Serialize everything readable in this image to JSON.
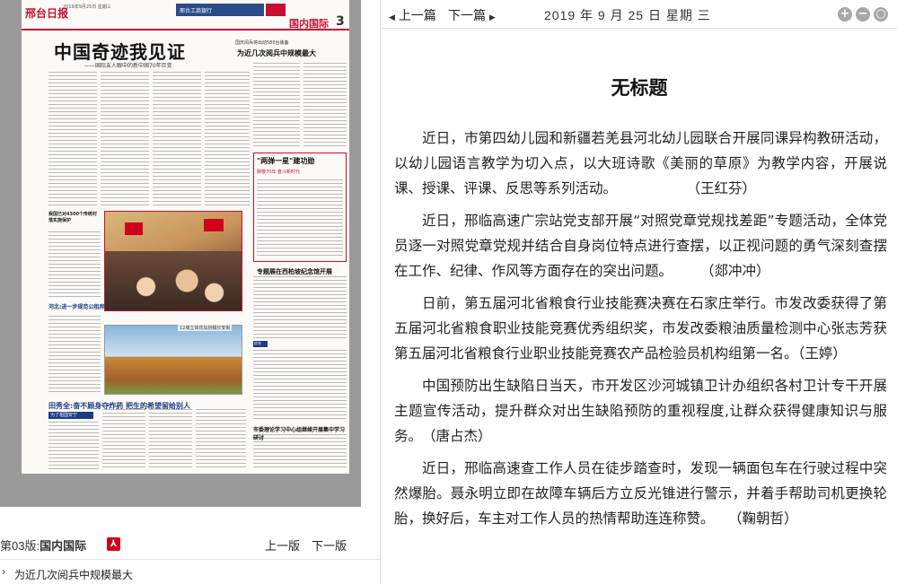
{
  "newspaper": {
    "logo": "邢台日报",
    "date_line": "2019年9月25日 星期三",
    "ad_text": "邢台工商银行",
    "section": "国内国际",
    "page_number": "3",
    "headline": "中国奇迹我见证",
    "subheadline": "——国际友人眼中的新中国70年巨变",
    "right_kicker": "国庆阅兵将出动580台装备",
    "right_headline": "为近几次阅兵中规模最大",
    "side_headline": "我国已对4300个传统村落实施保护",
    "side_headline2": "河北:进一步规范公租房分配管理",
    "photo1_caption": "香港举行爱国快闪活动",
    "photo2_caption": "12城立体花坛扮靓长安街",
    "bottom_headline": "田秀全:奋不顾身夺炸药 把生的希望留给别人",
    "bottom_tag": "为了祖国安宁",
    "box_headline": "\"两弹一星\"建功勋",
    "box_label": "致敬70年 奋斗新时代",
    "right_headline2": "专题展在西柏坡纪念馆开展",
    "tiny_label": "综合",
    "right_headline3": "市委理论学习中心组继续开展集中学习研讨"
  },
  "page_bar": {
    "page_prefix": "第03版:",
    "page_name": "国内国际",
    "pdf_icon_glyph": "⅄",
    "prev_page": "上一版",
    "next_page": "下一版"
  },
  "article_list": [
    {
      "title": "为近几次阅兵中规模最大"
    }
  ],
  "top_bar": {
    "prev_article": "上一篇",
    "next_article": "下一篇",
    "date": "2019 年 9 月 25 日  星期 三",
    "zoom_in": "+",
    "zoom_out": "−",
    "zoom_reset": "○"
  },
  "article": {
    "title": "无标题",
    "paragraphs": [
      "近日，市第四幼儿园和新疆若羌县河北幼儿园联合开展同课异构教研活动，以幼儿园语言教学为切入点，以大班诗歌《美丽的草原》为教学内容，开展说课、授课、评课、反思等系列活动。　　　　　　（王红芬）",
      "近日，邢临高速广宗站党支部开展“对照党章党规找差距”专题活动，全体党员逐一对照党章党规并结合自身岗位特点进行查摆，以正视问题的勇气深刻查摆在工作、纪律、作风等方面存在的突出问题。　　　（郯冲冲）",
      "日前，第五届河北省粮食行业技能赛决赛在石家庄举行。市发改委获得了第五届河北省粮食职业技能竞赛优秀组织奖，市发改委粮油质量检测中心张志芳获第五届河北省粮食行业职业技能竞赛农产品检验员机构组第一名。（王婷）",
      "中国预防出生缺陷日当天，市开发区沙河城镇卫计办组织各村卫计专干开展主题宣传活动，提升群众对出生缺陷预防的重视程度,让群众获得健康知识与服务。　（唐占杰）",
      "近日，邢临高速查工作人员在徒步踏查时，发现一辆面包车在行驶过程中突然爆胎。聂永明立即在故障车辆后方立反光锥进行警示，并着手帮助司机更换轮胎，换好后，车主对工作人员的热情帮助连连称赞。　　（鞠朝哲）"
    ]
  },
  "colors": {
    "accent_red": "#c8102e",
    "newspaper_blue": "#1a3c8a",
    "zoom_button_grey": "#a8a8a8"
  }
}
